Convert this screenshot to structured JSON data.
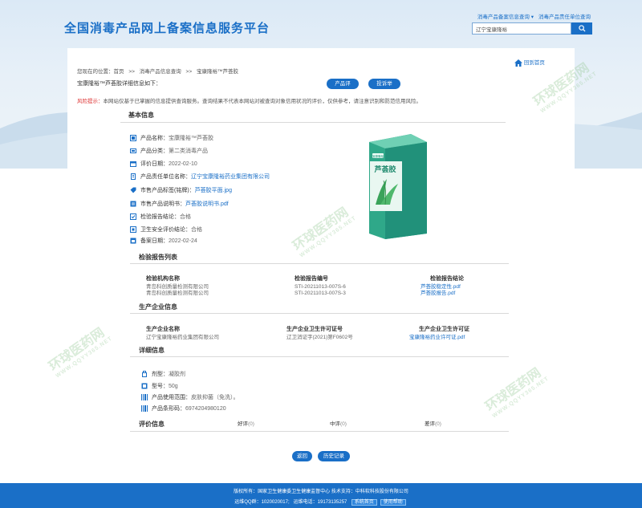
{
  "header": {
    "site_title": "全国消毒产品网上备案信息服务平台",
    "toplinks": [
      "消毒产品备案信息查询 ▾",
      "消毒产品责任单位查询"
    ],
    "search_value": "辽宁宝康隆裕"
  },
  "breadcrumb": [
    "您现在的位置：首页",
    ">>",
    "消毒产品信息查询",
    ">>",
    "宝康隆裕™芦荟胶"
  ],
  "home_link": "回到首页",
  "detail_heading": "宝康隆裕™芦荟胶详细信息如下：",
  "buttons": {
    "product_eval": "产品评价",
    "complaint": "投诉举报",
    "back": "返回",
    "history": "历史记录"
  },
  "risk": {
    "label": "风险提示：",
    "text": "本网站仅基于已掌握的信息提供查询服务。查询结果不代表本网站对被查询对象信用状况的评价，仅供参考，请注意识别和防范信用风险。"
  },
  "basic": {
    "title": "基本信息",
    "fields": [
      {
        "label": "产品名称：",
        "value": "宝康隆裕™芦荟胶",
        "link": false
      },
      {
        "label": "产品分类：",
        "value": "第二类消毒产品",
        "link": false
      },
      {
        "label": "评价日期：",
        "value": "2022-02-10",
        "link": false
      },
      {
        "label": "产品责任单位名称：",
        "value": "辽宁宝康隆裕药业集团有限公司",
        "link": true
      },
      {
        "label": "市售产品标签(铭牌)：",
        "value": "芦荟胶平面.jpg",
        "link": true
      },
      {
        "label": "市售产品说明书：",
        "value": "芦荟胶说明书.pdf",
        "link": true
      },
      {
        "label": "检验报告结论：",
        "value": "合格",
        "link": false
      },
      {
        "label": "卫生安全评价结论：",
        "value": "合格",
        "link": false
      },
      {
        "label": "备案日期：",
        "value": "2022-02-24",
        "link": false
      }
    ],
    "image": {
      "brand": "宝康隆裕",
      "product_name": "芦荟胶"
    }
  },
  "inspection": {
    "title": "检验报告列表",
    "headers": [
      "检验机构名称",
      "检验报告编号",
      "检验报告结论"
    ],
    "rows": [
      [
        "青岛科创质量检测有限公司",
        "STI-20211013-007S-6",
        "芦荟胶稳定性.pdf"
      ],
      [
        "青岛科创质量检测有限公司",
        "STI-20211013-007S-3",
        "芦荟胶报告.pdf"
      ]
    ]
  },
  "producer": {
    "title": "生产企业信息",
    "headers": [
      "生产企业名称",
      "生产企业卫生许可证号",
      "生产企业卫生许可证"
    ],
    "rows": [
      [
        "辽宁宝康隆裕药业集团有限公司",
        "辽卫消证字(2021)第F0602号",
        "宝康隆裕药业许可证.pdf"
      ]
    ]
  },
  "details": {
    "title": "详细信息",
    "fields": [
      {
        "label": "剂型：",
        "value": "凝胶剂"
      },
      {
        "label": "型号：",
        "value": "50g"
      },
      {
        "label": "产品使用范围：",
        "value": "皮肤抑菌（免洗）。"
      },
      {
        "label": "产品条形码：",
        "value": "6974204980120"
      }
    ]
  },
  "ratings": {
    "title": "评价信息",
    "good": "好评",
    "good_count": "(0)",
    "mid": "中评",
    "mid_count": "(0)",
    "bad": "差评",
    "bad_count": "(0)"
  },
  "footer": {
    "line1": "版权所有：国家卫生健康委卫生健康监督中心   技术支持：中科软科技股份有限公司",
    "qq_label": "运维QQ群：",
    "qq": "1020020017;",
    "phone_label": "运维电话：",
    "phone": "19173135257",
    "tag1": "系统首页",
    "tag2": "使用帮助"
  },
  "watermark": {
    "text": "环球医药网",
    "sub": "WWW.QQYY365.NET"
  },
  "colors": {
    "primary": "#1a6fc7",
    "risk": "#dd3333",
    "footer": "#1a6fc7"
  }
}
